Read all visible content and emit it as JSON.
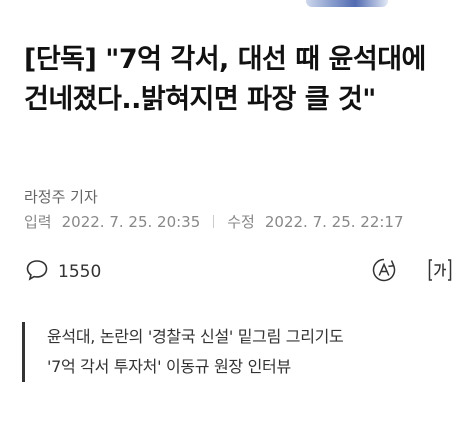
{
  "article": {
    "headline": "[단독] \"7억 각서, 대선 때 윤석대에 건네졌다..밝혀지면 파장 클 것\"",
    "reporter": "라정주 기자",
    "input_label": "입력",
    "input_date": "2022. 7. 25. 20:35",
    "modified_label": "수정",
    "modified_date": "2022. 7. 25. 22:17",
    "comment_count": "1550",
    "summary": [
      "윤석대, 논란의 '경찰국 신설' 밑그림 그리기도",
      "'7억 각서 투자처' 이동규 원장 인터뷰"
    ]
  },
  "icons": {
    "comment": "speech-bubble-icon",
    "font_size": "font-size-icon",
    "translate": "translate-icon"
  },
  "colors": {
    "text_primary": "#111111",
    "text_secondary": "#888888",
    "quote_bar": "#333333"
  }
}
